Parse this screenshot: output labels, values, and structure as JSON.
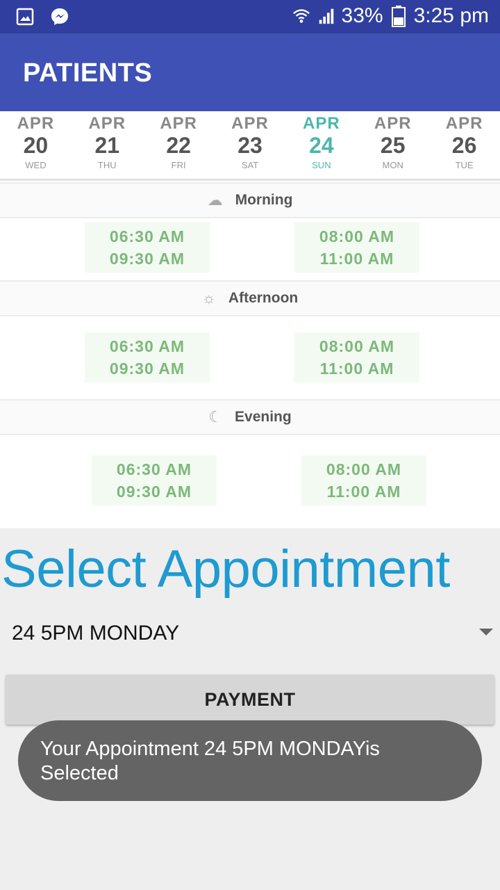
{
  "status_bar": {
    "battery": "33%",
    "time": "3:25 pm",
    "icons": [
      "gallery-icon",
      "messenger-icon",
      "wifi-icon",
      "signal-icon",
      "battery-icon"
    ]
  },
  "app_bar": {
    "title": "PATIENTS"
  },
  "dates": [
    {
      "month": "APR",
      "day": "20",
      "weekday": "WED",
      "active": false
    },
    {
      "month": "APR",
      "day": "21",
      "weekday": "THU",
      "active": false
    },
    {
      "month": "APR",
      "day": "22",
      "weekday": "FRI",
      "active": false
    },
    {
      "month": "APR",
      "day": "23",
      "weekday": "SAT",
      "active": false
    },
    {
      "month": "APR",
      "day": "24",
      "weekday": "SUN",
      "active": true
    },
    {
      "month": "APR",
      "day": "25",
      "weekday": "MON",
      "active": false
    },
    {
      "month": "APR",
      "day": "26",
      "weekday": "TUE",
      "active": false
    }
  ],
  "periods": [
    {
      "label": "Morning",
      "icon": "sunrise-icon",
      "slots": [
        [
          "06:30 AM",
          "09:30 AM"
        ],
        [
          "08:00 AM",
          "11:00 AM"
        ]
      ]
    },
    {
      "label": "Afternoon",
      "icon": "sun-icon",
      "slots": [
        [
          "06:30 AM",
          "09:30 AM"
        ],
        [
          "08:00 AM",
          "11:00 AM"
        ]
      ]
    },
    {
      "label": "Evening",
      "icon": "moon-icon",
      "slots": [
        [
          "06:30 AM",
          "09:30 AM"
        ],
        [
          "08:00 AM",
          "11:00 AM"
        ]
      ]
    }
  ],
  "main": {
    "title": "Select Appointment",
    "spinner_value": "24 5PM MONDAY",
    "payment_label": "PAYMENT",
    "toast": "Your Appointment 24 5PM MONDAYis Selected"
  },
  "colors": {
    "status_bar": "#303f9f",
    "app_bar": "#3f51b5",
    "title": "#1e9bd0",
    "active_date": "#4db6ac",
    "slot_text": "#7cb87a",
    "toast_bg": "#646464"
  }
}
